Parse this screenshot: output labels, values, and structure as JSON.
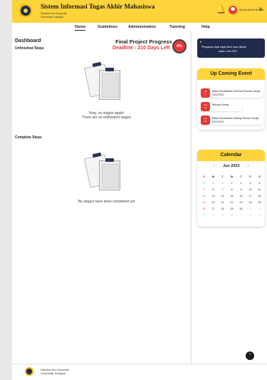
{
  "header": {
    "title": "Sistem Informasi Tugas Akhir Mahasiswa",
    "sub1": "Fakultas Ilmu Komputer",
    "sub2": "Universitas Sriwijaya",
    "notification_icon": "bell-icon",
    "user_name": "Ahmad Akmal Noviran",
    "accent": "#ffd33a"
  },
  "nav": {
    "items": [
      "Home",
      "Guidelines",
      "Administration",
      "Tutoring",
      "Help"
    ],
    "active": "Home"
  },
  "dashboard": {
    "title": "Dashboard",
    "unfinished_label": "Unfinished Steps",
    "progress_title": "Final Project Progress",
    "deadline": "Deadline : 210 Days Left",
    "progress_percent": "0%",
    "empty_unfinished_line1": "Yeay, no stages again!",
    "empty_unfinished_line2": "There are no unfinished stages",
    "complete_label": "Complete Steps",
    "empty_complete": "No stages have been completed yet"
  },
  "notice": {
    "line1": "Pengajuan topik tugas akhir akan dibuka",
    "line2": "pada 1 Juli 2022"
  },
  "events": {
    "title": "Up Coming Event",
    "items": [
      {
        "date_day": "7",
        "date_month": "Jun",
        "text": "Batas Pendaftaran Seminar Periode Genap 2021/2022"
      },
      {
        "date_day": "14",
        "date_month": "Jun",
        "text": "Wisuda Genap"
      },
      {
        "date_day": "21",
        "date_month": "Jun",
        "text": "Batas Pendaftaran Sidang Periode Genap 2021/2022"
      }
    ]
  },
  "calendar": {
    "title": "Calendar",
    "month": "Jun 2022",
    "prev": "<",
    "next": ">",
    "weekdays": [
      "S",
      "M",
      "T",
      "W",
      "T",
      "F",
      "S"
    ],
    "weeks": [
      [
        "29",
        "30",
        "31",
        "1",
        "2",
        "3",
        "4"
      ],
      [
        "5",
        "6",
        "7",
        "8",
        "9",
        "10",
        "11"
      ],
      [
        "12",
        "13",
        "14",
        "15",
        "16",
        "17",
        "18"
      ],
      [
        "19",
        "20",
        "21",
        "22",
        "23",
        "24",
        "25"
      ],
      [
        "26",
        "27",
        "28",
        "29",
        "30",
        "1",
        "2"
      ],
      [
        "3",
        "4",
        "5",
        "6",
        "7",
        "8",
        "9"
      ]
    ],
    "muted_first_week": 3,
    "muted_last_week_from": 5
  },
  "footer": {
    "line1": "Fakultas Ilmu Komputer",
    "line2": "Universitas Sriwijaya"
  },
  "scroll_top_icon": "chevron-up-icon"
}
